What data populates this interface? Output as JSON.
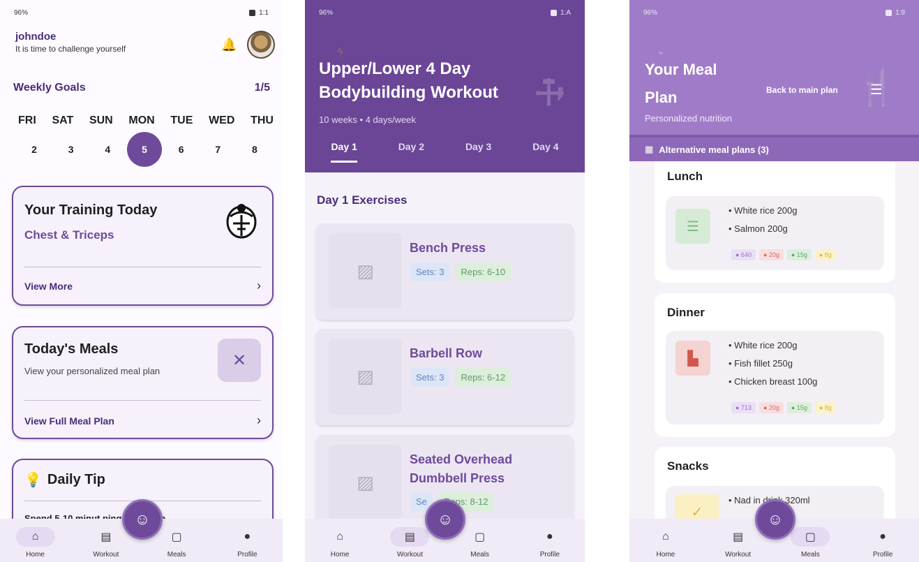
{
  "status": {
    "p1_left": "96%",
    "p1_right": "1:1",
    "p2_left": "96%",
    "p2_right": "1:A",
    "p3_left": "96%",
    "p3_right": "1:9"
  },
  "home": {
    "username": "johndoe",
    "tagline": "It is time to challenge yourself",
    "goals_title": "Weekly Goals",
    "goals_count": "1/5",
    "days": [
      "FRI",
      "SAT",
      "SUN",
      "MON",
      "TUE",
      "WED",
      "THU"
    ],
    "dates": [
      "2",
      "3",
      "4",
      "5",
      "6",
      "7",
      "8"
    ],
    "today_index": 3,
    "training": {
      "title": "Your Training Today",
      "subtitle": "Chest & Triceps",
      "link": "View More"
    },
    "meals": {
      "title": "Today's Meals",
      "desc": "View your personalized meal plan",
      "link": "View Full Meal Plan"
    },
    "tip": {
      "title": "Daily Tip",
      "text": "Spend 5-10 minut                  ping up before"
    }
  },
  "workout": {
    "title": "Upper/Lower 4 Day Bodybuilding Workout",
    "meta": "10 weeks • 4 days/week",
    "tabs": [
      "Day 1",
      "Day 2",
      "Day 3",
      "Day 4"
    ],
    "active_tab": 0,
    "section_title": "Day 1 Exercises",
    "exercises": [
      {
        "name": "Bench Press",
        "sets": "Sets: 3",
        "reps": "Reps: 6-10"
      },
      {
        "name": "Barbell Row",
        "sets": "Sets: 3",
        "reps": "Reps: 6-12"
      },
      {
        "name": "Seated Overhead Dumbbell Press",
        "sets": "Se",
        "reps": "Reps: 8-12"
      }
    ]
  },
  "mealplan": {
    "title": "Your Meal Plan",
    "subtitle": "Personalized nutrition",
    "back_label": "Back to main plan",
    "alt_label": "Alternative meal plans (3)",
    "meals": [
      {
        "name": "Lunch",
        "items": [
          "White rice 200g",
          "Salmon 200g"
        ],
        "macros": [
          "● 640",
          "● 20g",
          "● 15g",
          "● 8g"
        ],
        "icon_color": "#7dbb7f",
        "icon_bg": "#d6ebd6"
      },
      {
        "name": "Dinner",
        "items": [
          "White rice 200g",
          "Fish fillet 250g",
          "Chicken breast 100g"
        ],
        "macros": [
          "● 713",
          "● 20g",
          "● 15g",
          "● 8g"
        ],
        "icon_color": "#d2584e",
        "icon_bg": "#f5d3d0"
      },
      {
        "name": "Snacks",
        "items": [
          "Nad          in drink 320ml"
        ],
        "macros": [],
        "icon_color": "#d6b74a",
        "icon_bg": "#fbefc4"
      }
    ]
  },
  "nav": {
    "items": [
      "Home",
      "Workout",
      "Meals",
      "Profile"
    ],
    "icons": [
      "home-icon",
      "workout-icon",
      "meals-icon",
      "profile-icon"
    ]
  },
  "colors": {
    "primary": "#6f4a9a",
    "primary_dark": "#4a2c78",
    "hero_workout": "#6b4596",
    "hero_meal": "#a07cc8"
  }
}
